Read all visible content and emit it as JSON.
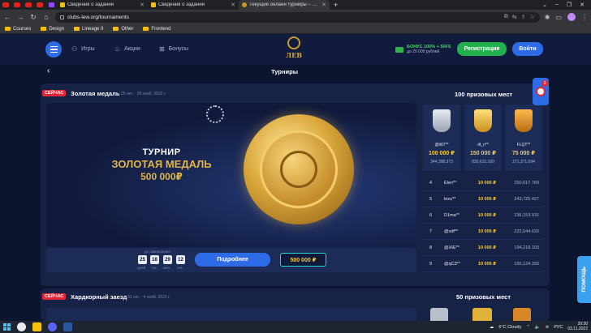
{
  "browser": {
    "tabs": [
      {
        "title": "Сведения о задании",
        "active": false
      },
      {
        "title": "Сведения о задании",
        "active": false
      },
      {
        "title": "Текущие онлайн турниры – каз…",
        "active": true
      }
    ],
    "new_tab": "+",
    "url": "clubs-lew.org/tournaments",
    "bookmarks": [
      "Courses",
      "Design",
      "Lineage II",
      "Other",
      "Frontend"
    ]
  },
  "header": {
    "menu": [
      {
        "label": "Игры",
        "icon": "gamepad-icon"
      },
      {
        "label": "Акции",
        "icon": "fire-icon"
      },
      {
        "label": "Бонусы",
        "icon": "gift-icon"
      }
    ],
    "logo_text": "ЛЕВ",
    "bonus_line1": "БОНУС 100% + 50FS",
    "bonus_line2": "до 20 000 рублей",
    "register_label": "Регистрация",
    "login_label": "Войти"
  },
  "page": {
    "back": "‹",
    "title": "Турниры"
  },
  "tournament": {
    "badge": "СЕЙЧАС",
    "name": "Золотая медаль",
    "dates": "25 окт. - 28 нояб. 2022 г.",
    "banner_line1": "ТУРНИР",
    "banner_line2": "ЗОЛОТАЯ МЕДАЛЬ",
    "banner_line3": "500 000₽",
    "timer_label": "до завершения",
    "timer": [
      {
        "value": "25",
        "unit": "дней"
      },
      {
        "value": "18",
        "unit": "час"
      },
      {
        "value": "29",
        "unit": "мин"
      },
      {
        "value": "12",
        "unit": "сек"
      }
    ],
    "details_label": "Подробнее",
    "prize_pool": "500 000 ₽",
    "places_title": "100 призовых мест",
    "podium": [
      {
        "user": "@ti07**",
        "prize": "100 000 ₽",
        "points": "344,398.373",
        "cup": "silver"
      },
      {
        "user": "dt_n**",
        "prize": "150 000 ₽",
        "points": "830,615.160",
        "cup": "gold"
      },
      {
        "user": "FLQT**",
        "prize": "75 000 ₽",
        "points": "271,371.094",
        "cup": "bronze"
      }
    ],
    "leaderboard": [
      {
        "place": "4",
        "user": "Elen**",
        "prize": "10 000 ₽",
        "points": "250,617.769"
      },
      {
        "place": "5",
        "user": "lexu**",
        "prize": "10 000 ₽",
        "points": "243,725.427"
      },
      {
        "place": "6",
        "user": "D1ma**",
        "prize": "10 000 ₽",
        "points": "236,153.531"
      },
      {
        "place": "7",
        "user": "@sdf**",
        "prize": "10 000 ₽",
        "points": "222,644.620"
      },
      {
        "place": "8",
        "user": "@XIE**",
        "prize": "10 000 ₽",
        "points": "194,218.103"
      },
      {
        "place": "9",
        "user": "@qC3**",
        "prize": "10 000 ₽",
        "points": "155,124.393"
      }
    ]
  },
  "tournament2": {
    "badge": "СЕЙЧАС",
    "name": "Хардкорный заезд",
    "dates": "31 окт. - 4 нояб. 2022 г.",
    "places_title": "50 призовых мест"
  },
  "floating": {
    "cart_count": "3",
    "help_label": "ПОМОЩЬ"
  },
  "taskbar": {
    "weather": "6°C  Cloudy",
    "lang": "РУС",
    "time": "20:30",
    "date": "03.11.2022"
  }
}
